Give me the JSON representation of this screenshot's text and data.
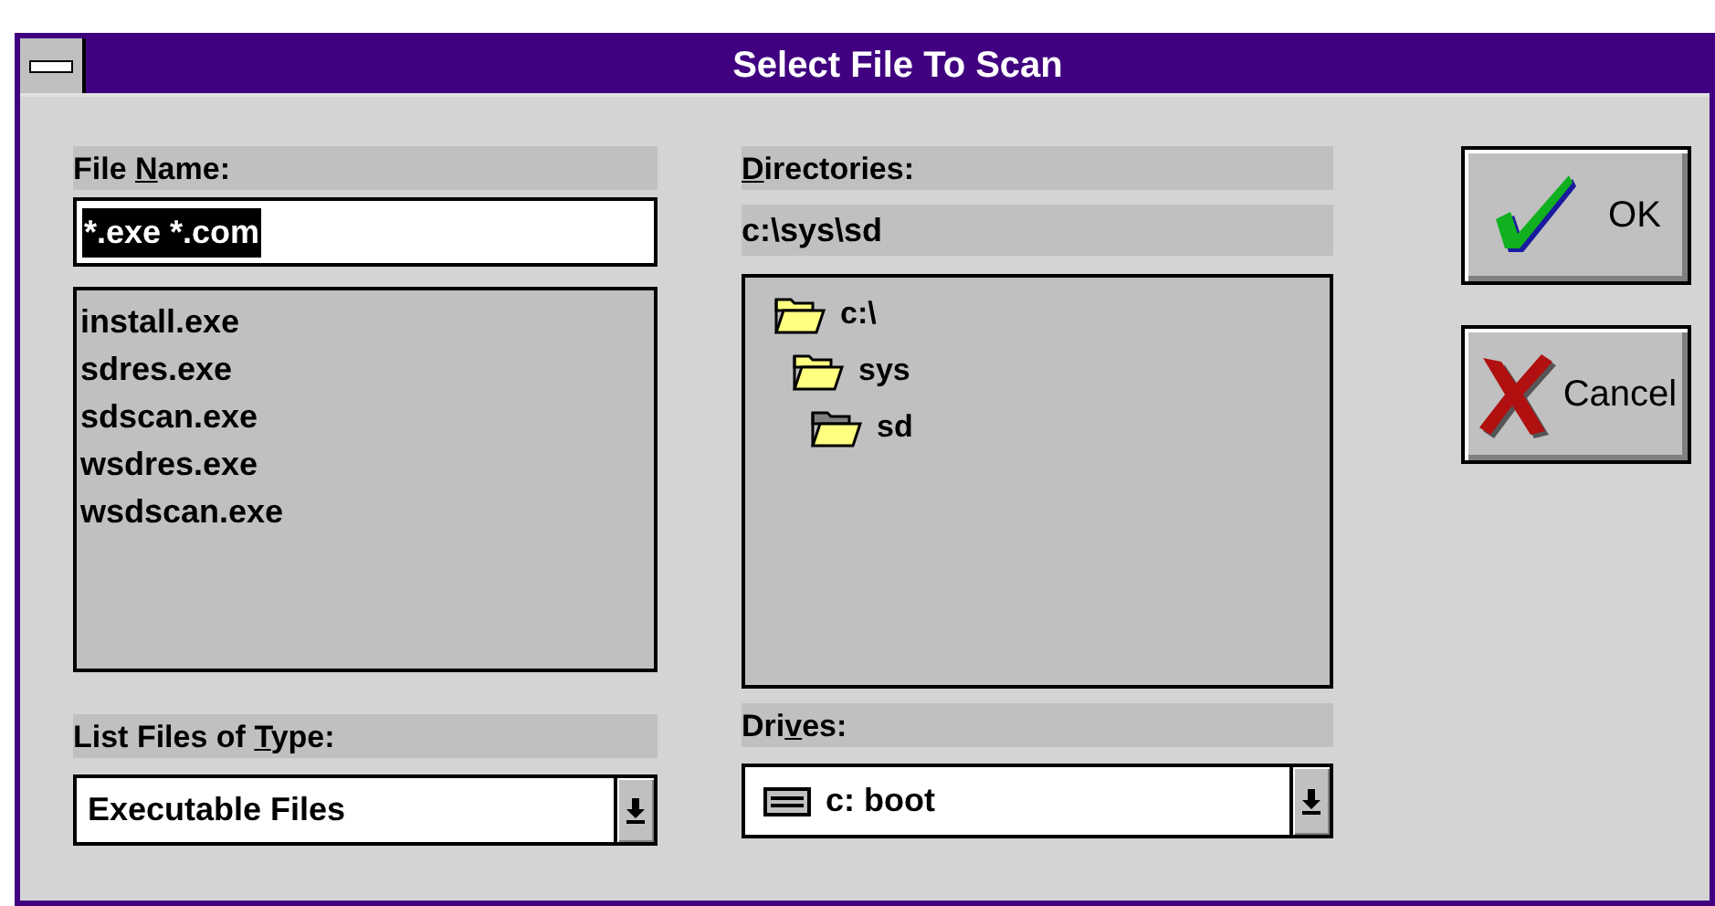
{
  "window": {
    "title": "Select File To Scan"
  },
  "file_name": {
    "label": {
      "before": "File ",
      "key": "N",
      "after": "ame:"
    },
    "value": "*.exe *.com",
    "value_selected": true
  },
  "files": [
    "install.exe",
    "sdres.exe",
    "sdscan.exe",
    "wsdres.exe",
    "wsdscan.exe"
  ],
  "directories": {
    "label": {
      "key": "D",
      "after": "irectories:"
    },
    "path": "c:\\sys\\sd",
    "tree": [
      {
        "name": "c:\\",
        "current": false,
        "children": [
          {
            "name": "sys",
            "current": false,
            "children": [
              {
                "name": "sd",
                "current": true
              }
            ]
          }
        ]
      }
    ]
  },
  "file_type": {
    "label": {
      "before": "List Files of ",
      "key": "T",
      "after": "ype:"
    },
    "value": "Executable Files"
  },
  "drives": {
    "label": {
      "before": "Dri",
      "key": "v",
      "after": "es:"
    },
    "value": "c: boot"
  },
  "buttons": [
    {
      "kind": "ok",
      "label": "OK"
    },
    {
      "kind": "cancel",
      "label": "Cancel"
    }
  ]
}
